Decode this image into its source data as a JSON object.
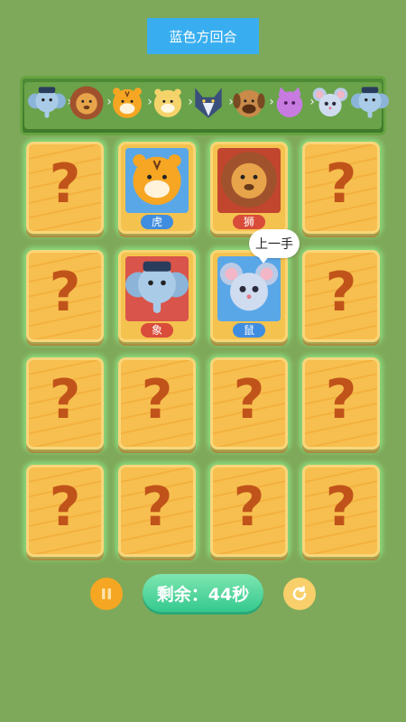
{
  "turn_banner": {
    "text": "蓝色方回合"
  },
  "chain": {
    "ranks": [
      {
        "animal": "elephant",
        "icon": "elephant-icon"
      },
      {
        "animal": "lion",
        "icon": "lion-icon"
      },
      {
        "animal": "tiger",
        "icon": "tiger-icon"
      },
      {
        "animal": "leopard",
        "icon": "leopard-icon"
      },
      {
        "animal": "wolf",
        "icon": "wolf-icon"
      },
      {
        "animal": "dog",
        "icon": "dog-icon"
      },
      {
        "animal": "cat",
        "icon": "cat-icon"
      },
      {
        "animal": "mouse",
        "icon": "mouse-icon"
      },
      {
        "animal": "elephant",
        "icon": "elephant-icon"
      }
    ],
    "separator": "›"
  },
  "board": {
    "back_symbol": "?",
    "cards": [
      {
        "state": "back"
      },
      {
        "state": "face",
        "animal": "tiger",
        "label": "虎",
        "side": "blue"
      },
      {
        "state": "face",
        "animal": "lion",
        "label": "狮",
        "side": "red"
      },
      {
        "state": "back"
      },
      {
        "state": "back"
      },
      {
        "state": "face",
        "animal": "elephant",
        "label": "象",
        "side": "red"
      },
      {
        "state": "face",
        "animal": "mouse",
        "label": "鼠",
        "side": "blue"
      },
      {
        "state": "back"
      },
      {
        "state": "back"
      },
      {
        "state": "back"
      },
      {
        "state": "back"
      },
      {
        "state": "back"
      },
      {
        "state": "back"
      },
      {
        "state": "back"
      },
      {
        "state": "back"
      },
      {
        "state": "back"
      }
    ]
  },
  "last_move_bubble": "上一手",
  "controls": {
    "timer_text": "剩余：44秒",
    "pause_icon": "pause-icon",
    "restart_icon": "restart-icon"
  },
  "colors": {
    "background": "#7fa95a",
    "banner": "#38aef0",
    "blue_side": "#3f8de0",
    "red_side": "#d94c3a",
    "card_back": "#f7bf4f",
    "question_mark": "#c0531a"
  }
}
